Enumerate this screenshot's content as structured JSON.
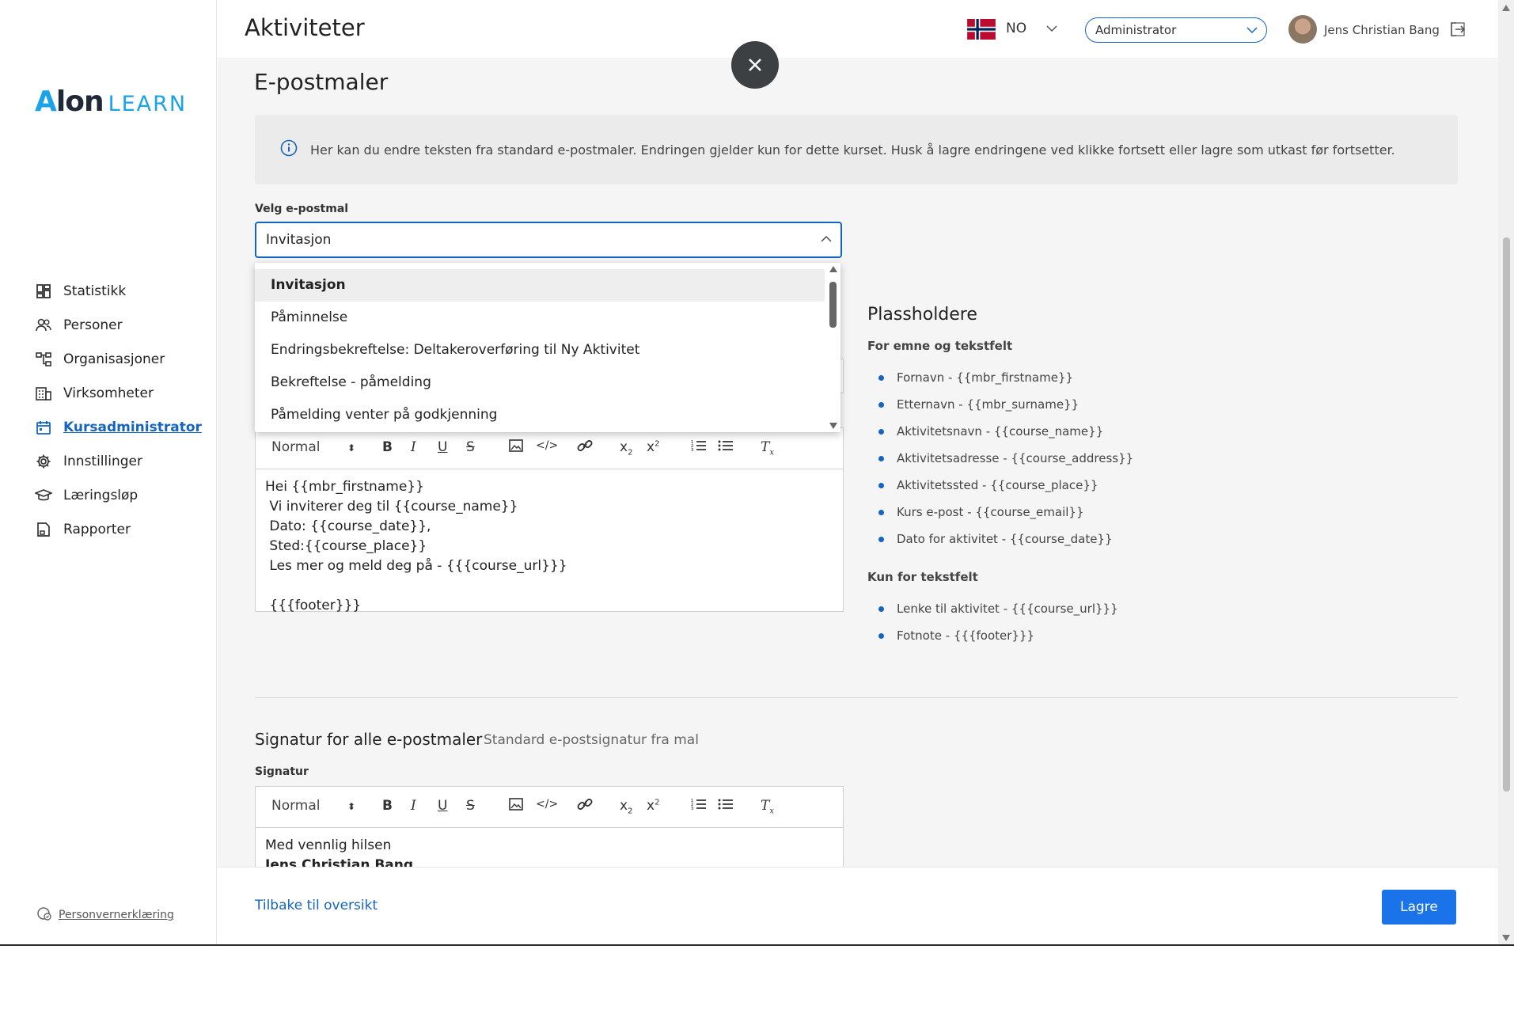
{
  "header": {
    "title": "Aktiviteter",
    "language": "NO",
    "role": "Administrator",
    "user_name": "Jens Christian Bang"
  },
  "sidebar": {
    "logo_alon": "lon",
    "logo_a": "A",
    "logo_learn": "LEARN",
    "items": [
      {
        "label": "Statistikk",
        "icon": "dashboard-icon"
      },
      {
        "label": "Personer",
        "icon": "people-icon"
      },
      {
        "label": "Organisasjoner",
        "icon": "org-chart-icon"
      },
      {
        "label": "Virksomheter",
        "icon": "building-icon"
      },
      {
        "label": "Kursadministrator",
        "icon": "calendar-icon",
        "active": true
      },
      {
        "label": "Innstillinger",
        "icon": "gear-icon"
      },
      {
        "label": "Læringsløp",
        "icon": "graduation-cap-icon"
      },
      {
        "label": "Rapporter",
        "icon": "report-icon"
      }
    ],
    "privacy": "Personvernerklæring"
  },
  "main": {
    "section_title": "E-postmaler",
    "info_text": "Her kan du endre teksten fra standard e-postmaler. Endringen gjelder kun for dette kurset. Husk å lagre endringene ved klikke fortsett eller lagre som utkast før fortsetter.",
    "select_label": "Velg e-postmal",
    "select_value": "Invitasjon",
    "dropdown_options": [
      "Invitasjon",
      "Påminnelse",
      "Endringsbekreftelse: Deltakeroverføring til Ny Aktivitet",
      "Bekreftelse - påmelding",
      "Påmelding venter på godkjenning"
    ],
    "editor_format": "Normal",
    "editor_lines": [
      "Hei {{mbr_firstname}}",
      " Vi inviterer deg til {{course_name}}",
      " Dato: {{course_date}},",
      " Sted:{{course_place}}",
      " Les mer og meld deg på - {{{course_url}}}",
      "",
      " {{{footer}}}"
    ],
    "placeholders": {
      "title": "Plassholdere",
      "subject_label": "For emne og tekstfelt",
      "subject_items": [
        "Fornavn - {{mbr_firstname}}",
        "Etternavn - {{mbr_surname}}",
        "Aktivitetsnavn - {{course_name}}",
        "Aktivitetsadresse - {{course_address}}",
        "Aktivitetssted - {{course_place}}",
        "Kurs e-post - {{course_email}}",
        "Dato for aktivitet - {{course_date}}"
      ],
      "text_label": "Kun for tekstfelt",
      "text_items": [
        "Lenke til aktivitet - {{{course_url}}}",
        "Fotnote - {{{footer}}}"
      ]
    },
    "signature_title": "Signatur for alle e-postmaler",
    "signature_sub": "Standard e-postsignatur fra mal",
    "signature_label": "Signatur",
    "signature_line1": "Med vennlig hilsen",
    "signature_line2": "Jens Christian Bang"
  },
  "footer": {
    "back_label": "Tilbake til oversikt",
    "save_label": "Lagre"
  },
  "colors": {
    "accent": "#1565c0",
    "primary_button": "#1a73e8",
    "logo_blue": "#1aa3e8"
  }
}
